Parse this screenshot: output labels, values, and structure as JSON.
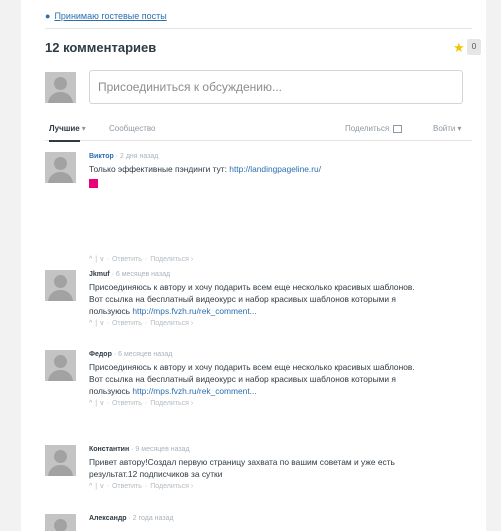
{
  "top_link": "Принимаю гостевые посты",
  "header": {
    "title": "12 комментариев",
    "star_count": "0"
  },
  "join": {
    "placeholder": "Присоединиться к обсуждению..."
  },
  "tabs": {
    "best": "Лучшие",
    "community": "Сообщество",
    "share": "Поделиться",
    "login": "Войти"
  },
  "actions": {
    "up": "^",
    "down": "v",
    "reply": "Ответить",
    "share": "Поделиться ›"
  },
  "comments": [
    {
      "author": "Виктор",
      "time": "2 дня назад",
      "lines": [
        "Только эффективные пэндинги тут:"
      ],
      "link": "http://landingpageline.ru/"
    },
    {
      "author": "Jkmuf",
      "time": "6 месяцев назад",
      "lines": [
        "Присоединяюсь к автору и хочу подарить всем еще несколько красивых шаблонов.",
        "Вот ссылка на бесплатный видеокурс и набор красивых шаблонов которыми я",
        "пользуюсь"
      ],
      "link": "http://mps.fvzh.ru/rek_comment..."
    },
    {
      "author": "Федор",
      "time": "6 месяцев назад",
      "lines": [
        "Присоединяюсь к автору и хочу подарить всем еще несколько красивых шаблонов.",
        "Вот ссылка на бесплатный видеокурс и набор красивых шаблонов которыми я",
        "пользуюсь"
      ],
      "link": "http://mps.fvzh.ru/rek_comment..."
    },
    {
      "author": "Константин",
      "time": "9 месяцев назад",
      "lines": [
        "Привет автору!Создал первую страницу захвата по вашим советам и уже есть",
        "результат.12 подписчиков за сутки"
      ]
    },
    {
      "author": "Александр",
      "time": "2 года назад",
      "lines": []
    }
  ]
}
